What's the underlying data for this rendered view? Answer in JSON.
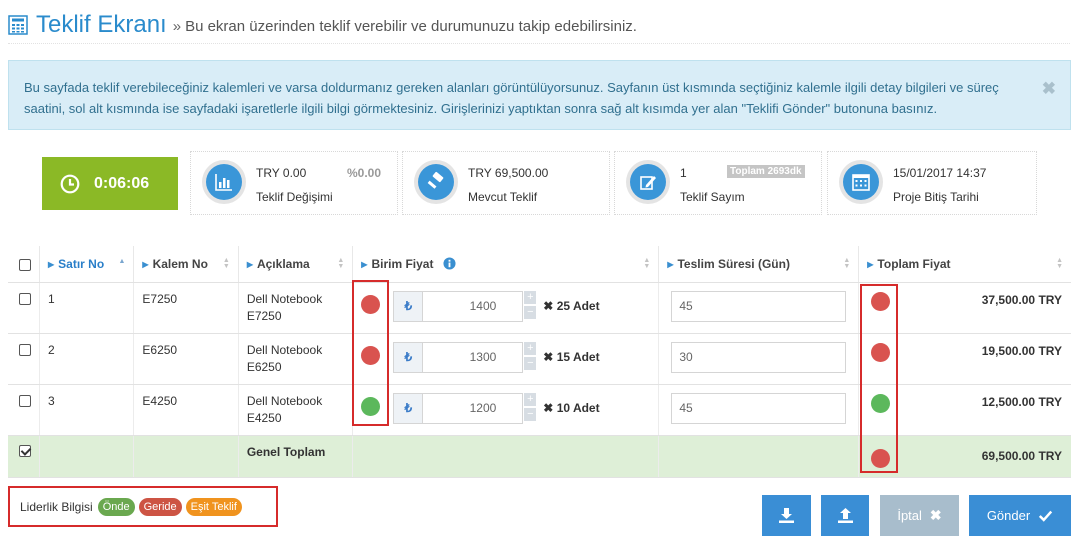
{
  "header": {
    "title": "Teklif Ekranı",
    "separator": "»",
    "subtitle": "Bu ekran üzerinden teklif verebilir ve durumunuzu takip edebilirsiniz."
  },
  "info": {
    "text": "Bu sayfada teklif verebileceğiniz kalemleri ve varsa doldurmanız gereken alanları görüntülüyorsunuz. Sayfanın üst kısmında seçtiğiniz kalemle ilgili detay bilgileri ve süreç saatini, sol alt kısmında ise sayfadaki işaretlerle ilgili bilgi görmektesiniz. Girişlerinizi yaptıktan sonra sağ alt kısımda yer alan \"Teklifi Gönder\" butonuna basınız.",
    "close": "✖"
  },
  "timer": {
    "value": "0:06:06"
  },
  "stats": [
    {
      "icon": "bar-chart-icon",
      "value": "TRY 0.00",
      "extra": "%0.00",
      "label": "Teklif Değişimi"
    },
    {
      "icon": "gavel-icon",
      "value": "TRY 69,500.00",
      "label": "Mevcut Teklif"
    },
    {
      "icon": "edit-icon",
      "value": "1",
      "extra": "Toplam 2693dk",
      "label": "Teklif Sayım"
    },
    {
      "icon": "calendar-icon",
      "value": "15/01/2017 14:37",
      "label": "Proje Bitiş Tarihi"
    }
  ],
  "table": {
    "headers": {
      "row_no": "Satır No",
      "item_no": "Kalem No",
      "description": "Açıklama",
      "unit_price": "Birim Fiyat",
      "delivery": "Teslim Süresi (Gün)",
      "total_price": "Toplam Fiyat"
    },
    "currency_symbol": "₺",
    "qty_prefix": "✖",
    "rows": [
      {
        "row_no": "1",
        "item_no": "E7250",
        "desc1": "Dell Notebook",
        "desc2": "E7250",
        "status": "red",
        "price": "1400",
        "qty": "25 Adet",
        "delivery": "45",
        "total_status": "red",
        "total": "37,500.00 TRY"
      },
      {
        "row_no": "2",
        "item_no": "E6250",
        "desc1": "Dell Notebook",
        "desc2": "E6250",
        "status": "red",
        "price": "1300",
        "qty": "15 Adet",
        "delivery": "30",
        "total_status": "red",
        "total": "19,500.00 TRY"
      },
      {
        "row_no": "3",
        "item_no": "E4250",
        "desc1": "Dell Notebook",
        "desc2": "E4250",
        "status": "green",
        "price": "1200",
        "qty": "10 Adet",
        "delivery": "45",
        "total_status": "green",
        "total": "12,500.00 TRY"
      }
    ],
    "grand_total": {
      "label": "Genel Toplam",
      "status": "red",
      "value": "69,500.00 TRY"
    }
  },
  "legend": {
    "label": "Liderlik Bilgisi",
    "items": [
      {
        "label": "Önde",
        "color": "#6aa84f"
      },
      {
        "label": "Geride",
        "color": "#cd5444"
      },
      {
        "label": "Eşit Teklif",
        "color": "#f0931e"
      }
    ]
  },
  "buttons": {
    "download_icon": "download-icon",
    "upload_icon": "upload-icon",
    "cancel": "İptal",
    "send": "Gönder"
  },
  "colors": {
    "accent": "#3a8ed5",
    "timer": "#8bb926",
    "leading": "#5cb85c",
    "behind": "#d9534f"
  }
}
